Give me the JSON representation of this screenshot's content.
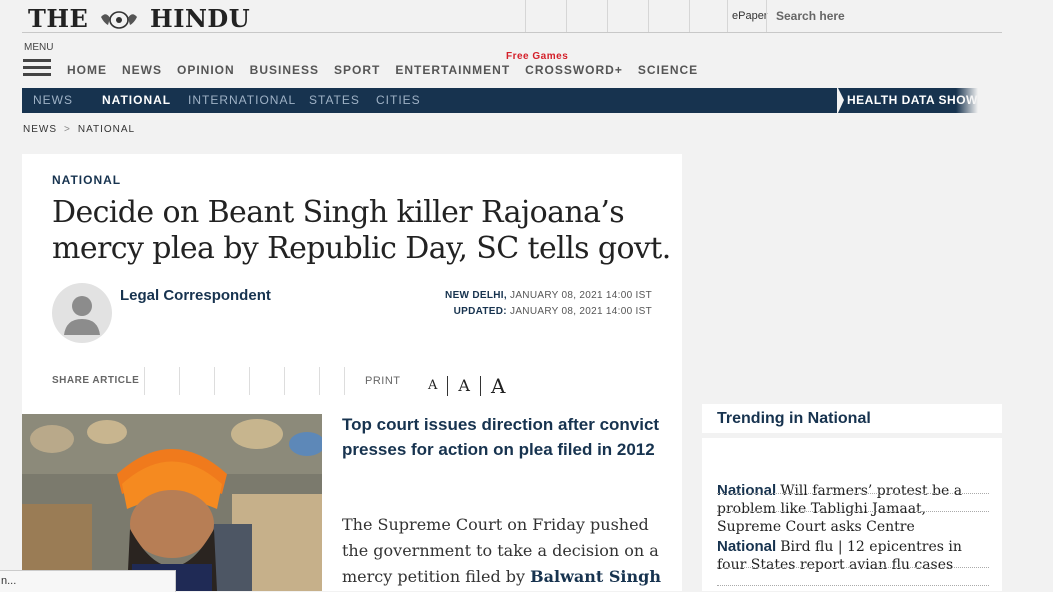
{
  "brand": {
    "logo_left": "THE",
    "logo_right": "HINDU"
  },
  "header": {
    "epaper": "ePaper",
    "search_placeholder": "Search here"
  },
  "menu": {
    "label": "MENU",
    "items": [
      "HOME",
      "NEWS",
      "OPINION",
      "BUSINESS",
      "SPORT",
      "ENTERTAINMENT",
      "CROSSWORD+",
      "SCIENCE"
    ],
    "promo": "Free Games"
  },
  "subnav": {
    "items": [
      "NEWS",
      "NATIONAL",
      "INTERNATIONAL",
      "STATES",
      "CITIES"
    ],
    "active": "NATIONAL",
    "banner": "HEALTH DATA SHOWS"
  },
  "breadcrumb": {
    "items": [
      "NEWS",
      "NATIONAL"
    ],
    "separator": ">"
  },
  "article": {
    "kicker": "NATIONAL",
    "headline": "Decide on Beant Singh killer Rajoana’s mercy plea by Republic Day, SC tells govt.",
    "author": "Legal Correspondent",
    "dateline_place": "NEW DELHI,",
    "dateline_date": "JANUARY 08, 2021 14:00 IST",
    "updated_label": "UPDATED:",
    "updated_date": "JANUARY 08, 2021 14:00 IST",
    "share_label": "SHARE ARTICLE",
    "print_label": "PRINT",
    "font_size_glyphs": [
      "A",
      "A",
      "A"
    ],
    "dek": "Top court issues direction after convict presses for action on plea filed in 2012",
    "body_start": "The Supreme Court on Friday pushed the government to take a decision on a mercy petition filed by ",
    "body_link": "Balwant Singh"
  },
  "trending": {
    "title": "Trending in National",
    "items": [
      {
        "tag": "National",
        "text": "Will farmers’ protest be a problem like Tablighi Jamaat, Supreme Court asks Centre"
      },
      {
        "tag": "National",
        "text": "Bird flu | 12 epicentres in four States report avian flu cases"
      }
    ]
  },
  "statusbar": {
    "text": "n..."
  },
  "colors": {
    "navy": "#17334f",
    "promo_red": "#d4202a",
    "page_bg": "#f2f2f2"
  }
}
